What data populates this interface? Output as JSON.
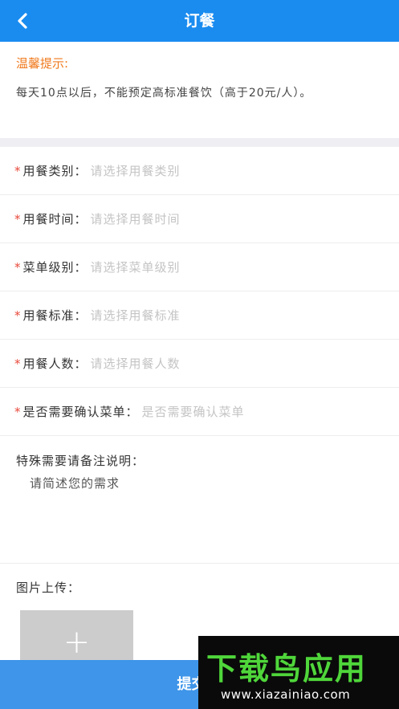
{
  "header": {
    "title": "订餐",
    "back_icon": "chevron-left-icon"
  },
  "notice": {
    "title": "温馨提示:",
    "text": "每天10点以后，不能预定高标准餐饮（高于20元/人）。"
  },
  "form": {
    "required_mark": "*",
    "fields": [
      {
        "label": "用餐类别：",
        "placeholder": "请选择用餐类别"
      },
      {
        "label": "用餐时间：",
        "placeholder": "请选择用餐时间"
      },
      {
        "label": "菜单级别：",
        "placeholder": "请选择菜单级别"
      },
      {
        "label": "用餐标准：",
        "placeholder": "请选择用餐标准"
      },
      {
        "label": "用餐人数：",
        "placeholder": "请选择用餐人数"
      },
      {
        "label": "是否需要确认菜单：",
        "placeholder": "是否需要确认菜单"
      }
    ]
  },
  "remark": {
    "label": "特殊需要请备注说明：",
    "placeholder": "请简述您的需求",
    "value": ""
  },
  "upload": {
    "label": "图片上传：",
    "add_symbol": "+"
  },
  "submit": {
    "label": "提交"
  },
  "watermark": {
    "brand": "下载鸟应用",
    "url": "www.xiazainiao.com"
  },
  "colors": {
    "header": "#1a8cf0",
    "notice_title": "#f07a1e",
    "required": "#e8493b",
    "submit": "#3e95e9"
  }
}
